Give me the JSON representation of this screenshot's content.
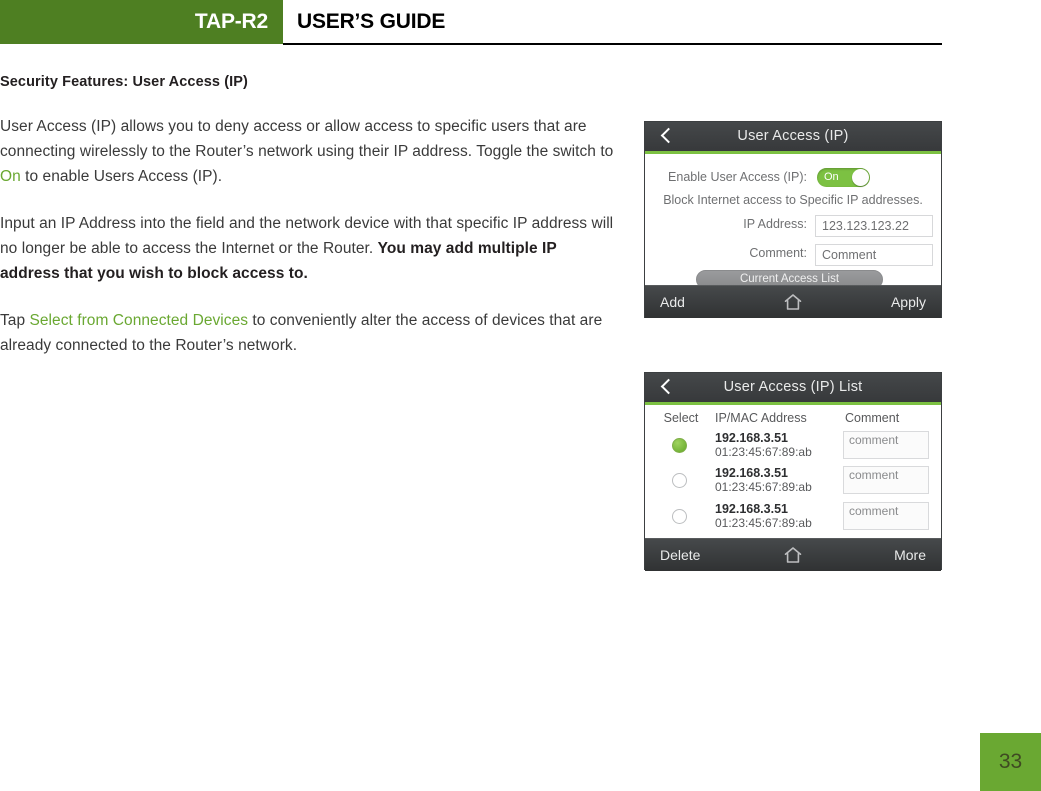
{
  "header": {
    "model": "TAP-R2",
    "title": "USER’S GUIDE"
  },
  "content": {
    "section_title": "Security Features: User Access (IP)",
    "paragraph_1_part_1": "User Access (IP) allows you to deny access or allow access to specific users that are connecting wirelessly to the Router’s network using their IP address.  Toggle the switch to ",
    "paragraph_1_accent": "On",
    "paragraph_1_part_2": " to enable Users Access (IP).",
    "paragraph_2_part_1": "Input an IP Address into the field and the network device with that specific IP address will no longer be able to access the Internet or the Router.  ",
    "paragraph_2_bold": "You may add multiple IP address that you wish to block access to.",
    "paragraph_3_part_1": "Tap ",
    "paragraph_3_accent": "Select from Connected Devices",
    "paragraph_3_part_2": " to conveniently alter the access of devices that are already connected to the Router’s network."
  },
  "panel_user_access": {
    "title": "User Access (IP)",
    "back_icon": "back-chevron-icon",
    "enable_label": "Enable User Access (IP):",
    "toggle_value": "On",
    "hint": "Block Internet access to Specific IP addresses.",
    "ip_label": "IP Address:",
    "ip_value": "123.123.123.22",
    "comment_label": "Comment:",
    "comment_value": "Comment",
    "current_list_button": "Current Access List",
    "footer_left": "Add",
    "footer_home_icon": "home-icon",
    "footer_right": "Apply"
  },
  "panel_access_list": {
    "title": "User Access (IP) List",
    "back_icon": "back-chevron-icon",
    "columns": [
      "Select",
      "IP/MAC Address",
      "Comment"
    ],
    "rows": [
      {
        "selected": "selected",
        "ip": "192.168.3.51",
        "mac": "01:23:45:67:89:ab",
        "comment": "comment"
      },
      {
        "selected": "unselected",
        "ip": "192.168.3.51",
        "mac": "01:23:45:67:89:ab",
        "comment": "comment"
      },
      {
        "selected": "unselected",
        "ip": "192.168.3.51",
        "mac": "01:23:45:67:89:ab",
        "comment": "comment"
      }
    ],
    "footer_left": "Delete",
    "footer_home_icon": "home-icon",
    "footer_right": "More"
  },
  "footer": {
    "page_number": "33"
  },
  "colors": {
    "header_green": "#4e7f22",
    "accent_green": "#6aa832",
    "panel_green_line": "#7cc142",
    "panel_dark": "#3c3f41"
  }
}
